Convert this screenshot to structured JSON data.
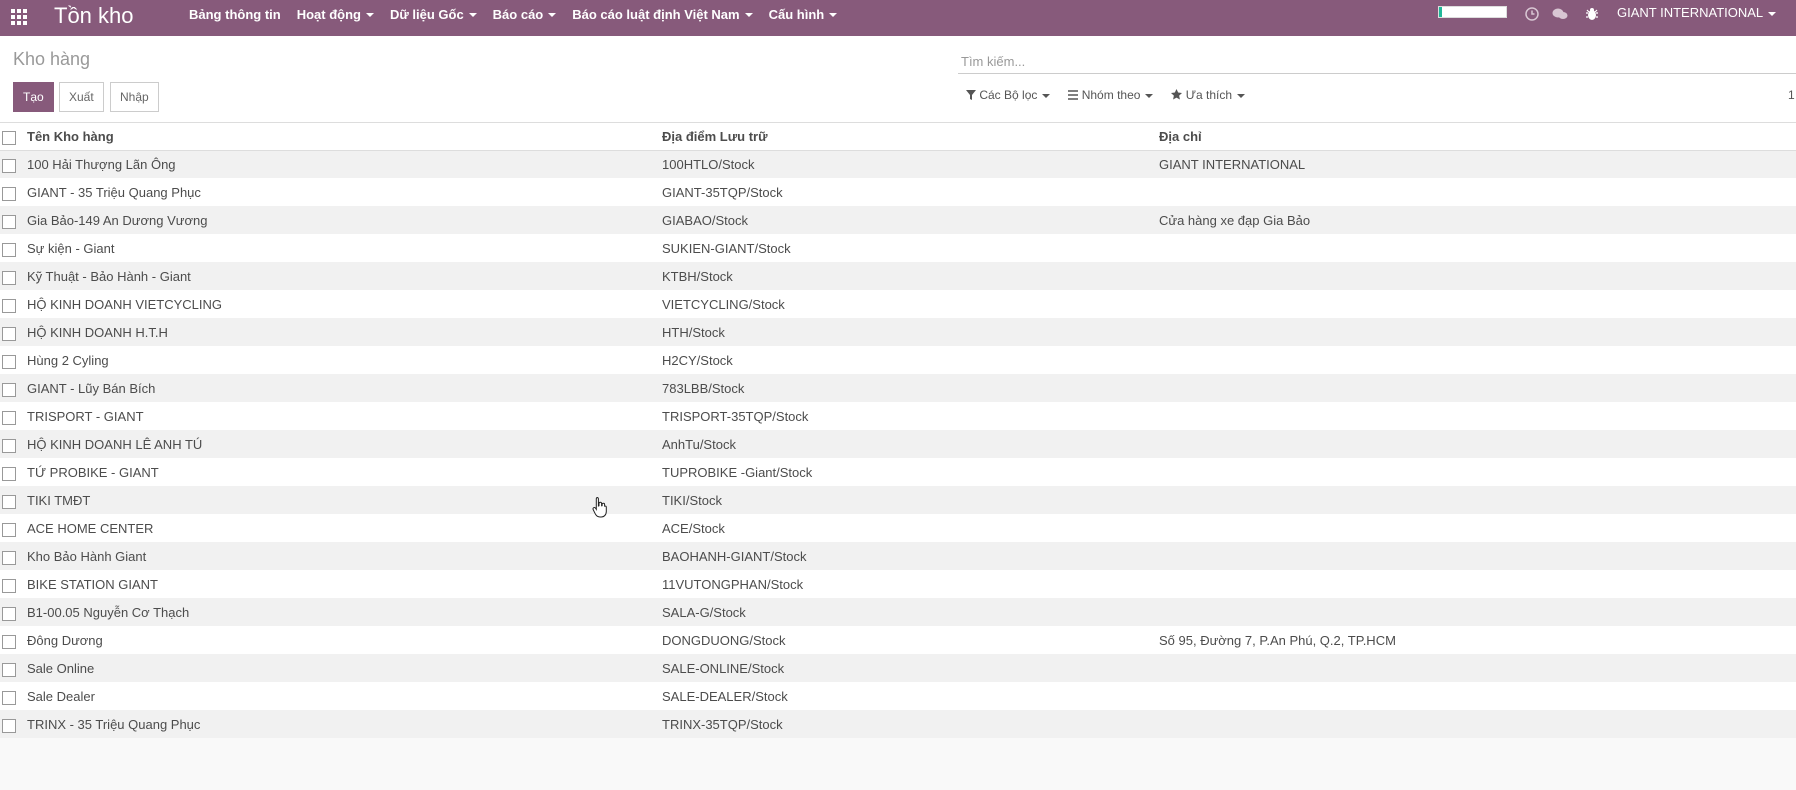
{
  "app": {
    "brand": "Tồn kho",
    "menu": [
      {
        "label": "Bảng thông tin",
        "dropdown": false
      },
      {
        "label": "Hoạt động",
        "dropdown": true
      },
      {
        "label": "Dữ liệu Gốc",
        "dropdown": true
      },
      {
        "label": "Báo cáo",
        "dropdown": true
      },
      {
        "label": "Báo cáo luật định Việt Nam",
        "dropdown": true
      },
      {
        "label": "Cấu hình",
        "dropdown": true
      }
    ],
    "company": "GIANT INTERNATIONAL",
    "accent_color": "#875a7b"
  },
  "control_panel": {
    "breadcrumb": "Kho hàng",
    "buttons": {
      "create": "Tạo",
      "export": "Xuất",
      "import": "Nhập"
    },
    "search_placeholder": "Tìm kiếm...",
    "filters": {
      "filters": "Các Bộ lọc",
      "group_by": "Nhóm theo",
      "favorites": "Ưa thích"
    },
    "pager": "1"
  },
  "table": {
    "headers": {
      "name": "Tên Kho hàng",
      "location": "Địa điểm Lưu trữ",
      "address": "Địa chỉ"
    },
    "rows": [
      {
        "name": "100 Hải Thượng Lãn Ông",
        "location": "100HTLO/Stock",
        "address": "GIANT INTERNATIONAL"
      },
      {
        "name": "GIANT - 35 Triệu Quang Phục",
        "location": "GIANT-35TQP/Stock",
        "address": ""
      },
      {
        "name": "Gia Bảo-149 An Dương Vương",
        "location": "GIABAO/Stock",
        "address": "Cửa hàng xe đạp Gia Bảo"
      },
      {
        "name": "Sự kiện - Giant",
        "location": "SUKIEN-GIANT/Stock",
        "address": ""
      },
      {
        "name": "Kỹ Thuật - Bảo Hành - Giant",
        "location": "KTBH/Stock",
        "address": ""
      },
      {
        "name": "HỘ KINH DOANH VIETCYCLING",
        "location": "VIETCYCLING/Stock",
        "address": ""
      },
      {
        "name": "HỘ KINH DOANH H.T.H",
        "location": "HTH/Stock",
        "address": ""
      },
      {
        "name": "Hùng 2 Cyling",
        "location": "H2CY/Stock",
        "address": ""
      },
      {
        "name": "GIANT - Lũy Bán Bích",
        "location": "783LBB/Stock",
        "address": ""
      },
      {
        "name": "TRISPORT - GIANT",
        "location": "TRISPORT-35TQP/Stock",
        "address": ""
      },
      {
        "name": "HỘ KINH DOANH LÊ ANH TÚ",
        "location": "AnhTu/Stock",
        "address": ""
      },
      {
        "name": "TỨ PROBIKE - GIANT",
        "location": "TUPROBIKE -Giant/Stock",
        "address": ""
      },
      {
        "name": "TIKI TMĐT",
        "location": "TIKI/Stock",
        "address": ""
      },
      {
        "name": "ACE HOME CENTER",
        "location": "ACE/Stock",
        "address": ""
      },
      {
        "name": "Kho Bảo Hành Giant",
        "location": "BAOHANH-GIANT/Stock",
        "address": ""
      },
      {
        "name": "BIKE STATION GIANT",
        "location": "11VUTONGPHAN/Stock",
        "address": ""
      },
      {
        "name": "B1-00.05 Nguyễn Cơ Thạch",
        "location": "SALA-G/Stock",
        "address": ""
      },
      {
        "name": "Đông Dương",
        "location": "DONGDUONG/Stock",
        "address": "Số 95, Đường 7, P.An Phú, Q.2, TP.HCM"
      },
      {
        "name": "Sale Online",
        "location": "SALE-ONLINE/Stock",
        "address": ""
      },
      {
        "name": "Sale Dealer",
        "location": "SALE-DEALER/Stock",
        "address": ""
      },
      {
        "name": "TRINX - 35 Triệu Quang Phục",
        "location": "TRINX-35TQP/Stock",
        "address": ""
      }
    ]
  }
}
